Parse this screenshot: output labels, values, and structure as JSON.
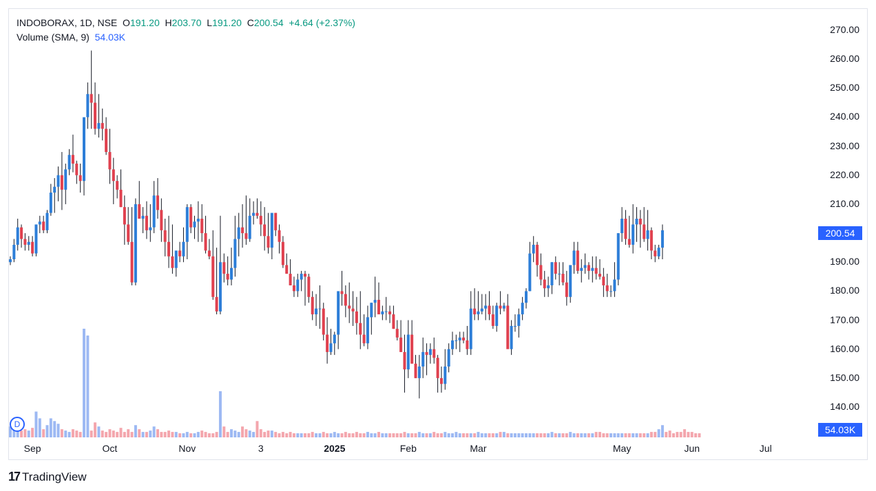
{
  "legend": {
    "symbol": "INDOBORAX, 1D, NSE",
    "o_label": "O",
    "o_value": "191.20",
    "h_label": "H",
    "h_value": "203.70",
    "l_label": "L",
    "l_value": "191.20",
    "c_label": "C",
    "c_value": "200.54",
    "change": "+4.64 (+2.37%)",
    "volume_label": "Volume (SMA, 9)",
    "volume_value": "54.03K"
  },
  "price_tag": "200.54",
  "volume_tag": "54.03K",
  "badge": "D",
  "brand": {
    "logo": "17",
    "name": "TradingView"
  },
  "colors": {
    "up": "#2d7ed8",
    "down": "#e0414f",
    "up_vol": "#9db9f3",
    "down_vol": "#f4a6ad",
    "accent": "#2962ff"
  },
  "chart_data": {
    "type": "candlestick",
    "title": "INDOBORAX, 1D, NSE",
    "y_ticks": [
      "270.00",
      "260.00",
      "250.00",
      "240.00",
      "230.00",
      "220.00",
      "210.00",
      "200.00",
      "190.00",
      "180.00",
      "170.00",
      "160.00",
      "150.00",
      "140.00"
    ],
    "ylim": [
      135,
      275
    ],
    "x_ticks": [
      {
        "label": "Sep",
        "index": 6,
        "bold": false
      },
      {
        "label": "Oct",
        "index": 27,
        "bold": false
      },
      {
        "label": "Nov",
        "index": 48,
        "bold": false
      },
      {
        "label": "3",
        "index": 68,
        "bold": false
      },
      {
        "label": "2025",
        "index": 88,
        "bold": true
      },
      {
        "label": "Feb",
        "index": 108,
        "bold": false
      },
      {
        "label": "Mar",
        "index": 127,
        "bold": false
      },
      {
        "label": "May",
        "index": 166,
        "bold": false
      },
      {
        "label": "Jun",
        "index": 185,
        "bold": false
      },
      {
        "label": "Jul",
        "index": 205,
        "bold": false
      }
    ],
    "candles": [
      [
        190,
        192,
        189,
        191
      ],
      [
        191,
        198,
        190,
        196
      ],
      [
        196,
        205,
        194,
        202
      ],
      [
        202,
        203,
        195,
        198
      ],
      [
        198,
        200,
        194,
        196
      ],
      [
        196,
        199,
        194,
        197
      ],
      [
        197,
        199,
        192,
        193
      ],
      [
        193,
        203,
        192,
        203
      ],
      [
        203,
        206,
        200,
        204
      ],
      [
        204,
        206,
        200,
        201
      ],
      [
        201,
        208,
        200,
        207
      ],
      [
        207,
        217,
        206,
        214
      ],
      [
        214,
        219,
        207,
        216
      ],
      [
        216,
        223,
        211,
        220
      ],
      [
        220,
        228,
        208,
        215
      ],
      [
        215,
        224,
        210,
        222
      ],
      [
        222,
        229,
        220,
        227
      ],
      [
        227,
        234,
        221,
        224
      ],
      [
        224,
        225,
        217,
        220
      ],
      [
        220,
        224,
        214,
        218
      ],
      [
        218,
        230,
        213,
        240
      ],
      [
        240,
        252,
        236,
        248
      ],
      [
        248,
        263,
        236,
        245
      ],
      [
        245,
        252,
        234,
        236
      ],
      [
        236,
        248,
        233,
        238
      ],
      [
        238,
        243,
        232,
        236
      ],
      [
        236,
        240,
        227,
        228
      ],
      [
        228,
        236,
        217,
        222
      ],
      [
        222,
        226,
        210,
        218
      ],
      [
        218,
        220,
        212,
        215
      ],
      [
        215,
        222,
        209,
        209
      ],
      [
        209,
        213,
        196,
        203
      ],
      [
        203,
        209,
        196,
        197
      ],
      [
        197,
        209,
        182,
        183
      ],
      [
        183,
        212,
        182,
        210
      ],
      [
        210,
        218,
        206,
        205
      ],
      [
        205,
        209,
        200,
        206
      ],
      [
        206,
        211,
        198,
        201
      ],
      [
        201,
        210,
        197,
        202
      ],
      [
        202,
        218,
        200,
        213
      ],
      [
        213,
        219,
        205,
        208
      ],
      [
        208,
        212,
        197,
        201
      ],
      [
        201,
        205,
        192,
        197
      ],
      [
        197,
        206,
        188,
        192
      ],
      [
        192,
        203,
        186,
        188
      ],
      [
        188,
        191,
        185,
        194
      ],
      [
        194,
        197,
        190,
        192
      ],
      [
        192,
        202,
        190,
        197
      ],
      [
        197,
        210,
        191,
        209
      ],
      [
        209,
        210,
        200,
        202
      ],
      [
        202,
        206,
        198,
        204
      ],
      [
        204,
        211,
        197,
        205
      ],
      [
        205,
        210,
        197,
        200
      ],
      [
        200,
        206,
        193,
        194
      ],
      [
        194,
        198,
        191,
        192
      ],
      [
        192,
        201,
        177,
        178
      ],
      [
        178,
        195,
        172,
        173
      ],
      [
        173,
        206,
        172,
        190
      ],
      [
        190,
        193,
        183,
        186
      ],
      [
        186,
        192,
        182,
        184
      ],
      [
        184,
        195,
        182,
        188
      ],
      [
        188,
        206,
        185,
        198
      ],
      [
        198,
        207,
        192,
        202
      ],
      [
        202,
        210,
        195,
        200
      ],
      [
        200,
        213,
        196,
        198
      ],
      [
        198,
        212,
        197,
        206
      ],
      [
        206,
        211,
        203,
        207
      ],
      [
        207,
        212,
        205,
        206
      ],
      [
        206,
        211,
        199,
        203
      ],
      [
        203,
        209,
        194,
        199
      ],
      [
        199,
        207,
        193,
        195
      ],
      [
        195,
        206,
        191,
        207
      ],
      [
        207,
        207,
        199,
        201
      ],
      [
        201,
        203,
        193,
        197
      ],
      [
        197,
        199,
        188,
        189
      ],
      [
        189,
        193,
        186,
        186
      ],
      [
        186,
        191,
        182,
        182
      ],
      [
        182,
        185,
        178,
        180
      ],
      [
        180,
        186,
        178,
        184
      ],
      [
        184,
        187,
        180,
        186
      ],
      [
        186,
        187,
        175,
        185
      ],
      [
        185,
        186,
        176,
        178
      ],
      [
        178,
        180,
        170,
        172
      ],
      [
        172,
        179,
        168,
        174
      ],
      [
        174,
        182,
        167,
        174
      ],
      [
        174,
        176,
        163,
        165
      ],
      [
        165,
        171,
        155,
        159
      ],
      [
        159,
        167,
        158,
        162
      ],
      [
        162,
        166,
        158,
        165
      ],
      [
        165,
        176,
        160,
        180
      ],
      [
        180,
        187,
        175,
        179
      ],
      [
        179,
        182,
        171,
        175
      ],
      [
        175,
        183,
        169,
        174
      ],
      [
        174,
        180,
        168,
        173
      ],
      [
        173,
        178,
        165,
        169
      ],
      [
        169,
        180,
        160,
        165
      ],
      [
        165,
        172,
        161,
        162
      ],
      [
        162,
        175,
        160,
        171
      ],
      [
        171,
        176,
        165,
        176
      ],
      [
        176,
        185,
        171,
        177
      ],
      [
        177,
        183,
        174,
        172
      ],
      [
        172,
        175,
        170,
        173
      ],
      [
        173,
        178,
        170,
        173
      ],
      [
        173,
        175,
        169,
        172
      ],
      [
        172,
        175,
        167,
        167
      ],
      [
        167,
        170,
        163,
        164
      ],
      [
        164,
        170,
        159,
        159
      ],
      [
        159,
        165,
        145,
        153
      ],
      [
        153,
        170,
        150,
        165
      ],
      [
        165,
        170,
        155,
        155
      ],
      [
        155,
        158,
        150,
        150
      ],
      [
        150,
        158,
        143,
        154
      ],
      [
        154,
        164,
        150,
        159
      ],
      [
        159,
        162,
        151,
        158
      ],
      [
        158,
        162,
        155,
        160
      ],
      [
        160,
        164,
        155,
        157
      ],
      [
        157,
        158,
        145,
        150
      ],
      [
        150,
        154,
        145,
        148
      ],
      [
        148,
        160,
        146,
        154
      ],
      [
        154,
        162,
        152,
        160
      ],
      [
        160,
        166,
        158,
        163
      ],
      [
        163,
        165,
        160,
        163
      ],
      [
        163,
        166,
        159,
        164
      ],
      [
        164,
        166,
        162,
        163
      ],
      [
        163,
        168,
        158,
        160
      ],
      [
        160,
        180,
        158,
        174
      ],
      [
        174,
        181,
        170,
        172
      ],
      [
        172,
        180,
        170,
        173
      ],
      [
        173,
        179,
        172,
        174
      ],
      [
        174,
        179,
        170,
        175
      ],
      [
        175,
        180,
        170,
        172
      ],
      [
        172,
        175,
        167,
        168
      ],
      [
        168,
        176,
        166,
        175
      ],
      [
        175,
        180,
        172,
        174
      ],
      [
        174,
        176,
        173,
        175
      ],
      [
        175,
        179,
        162,
        160
      ],
      [
        160,
        170,
        158,
        168
      ],
      [
        168,
        172,
        166,
        168
      ],
      [
        168,
        174,
        164,
        172
      ],
      [
        172,
        178,
        170,
        176
      ],
      [
        176,
        181,
        174,
        180
      ],
      [
        180,
        197,
        180,
        193
      ],
      [
        193,
        199,
        190,
        196
      ],
      [
        196,
        197,
        185,
        189
      ],
      [
        189,
        193,
        182,
        184
      ],
      [
        184,
        187,
        178,
        181
      ],
      [
        181,
        185,
        178,
        182
      ],
      [
        182,
        190,
        179,
        190
      ],
      [
        190,
        192,
        184,
        186
      ],
      [
        186,
        190,
        182,
        186
      ],
      [
        186,
        190,
        182,
        183
      ],
      [
        183,
        187,
        175,
        178
      ],
      [
        178,
        188,
        176,
        189
      ],
      [
        189,
        197,
        186,
        194
      ],
      [
        194,
        197,
        186,
        187
      ],
      [
        187,
        191,
        183,
        188
      ],
      [
        188,
        193,
        186,
        189
      ],
      [
        189,
        190,
        184,
        187
      ],
      [
        187,
        192,
        183,
        188
      ],
      [
        188,
        192,
        184,
        186
      ],
      [
        186,
        191,
        184,
        185
      ],
      [
        185,
        188,
        178,
        182
      ],
      [
        182,
        186,
        178,
        180
      ],
      [
        180,
        182,
        178,
        180
      ],
      [
        180,
        190,
        178,
        184
      ],
      [
        184,
        200,
        182,
        200
      ],
      [
        200,
        209,
        197,
        205
      ],
      [
        205,
        208,
        196,
        198
      ],
      [
        198,
        206,
        195,
        196
      ],
      [
        196,
        210,
        193,
        203
      ],
      [
        203,
        209,
        197,
        205
      ],
      [
        205,
        208,
        195,
        203
      ],
      [
        203,
        209,
        197,
        198
      ],
      [
        198,
        208,
        194,
        201
      ],
      [
        201,
        202,
        191,
        194
      ],
      [
        194,
        196,
        190,
        192
      ],
      [
        192,
        196,
        191,
        195
      ],
      [
        195,
        203,
        191,
        201
      ]
    ],
    "volume": [
      8,
      6,
      10,
      5,
      6,
      5,
      7,
      19,
      14,
      6,
      9,
      14,
      12,
      10,
      6,
      5,
      4,
      6,
      5,
      4,
      80,
      75,
      5,
      11,
      8,
      5,
      4,
      6,
      5,
      4,
      7,
      4,
      6,
      4,
      9,
      6,
      4,
      4,
      5,
      8,
      6,
      4,
      4,
      5,
      4,
      4,
      3,
      3,
      4,
      3,
      3,
      4,
      5,
      4,
      3,
      3,
      4,
      34,
      8,
      4,
      6,
      5,
      4,
      8,
      6,
      5,
      4,
      12,
      6,
      4,
      5,
      5,
      4,
      3,
      4,
      3,
      4,
      3,
      3,
      3,
      3,
      3,
      4,
      3,
      3,
      4,
      3,
      3,
      4,
      3,
      3,
      4,
      3,
      3,
      4,
      3,
      3,
      4,
      3,
      3,
      4,
      3,
      3,
      3,
      3,
      3,
      3,
      4,
      3,
      3,
      3,
      4,
      3,
      3,
      3,
      4,
      3,
      3,
      4,
      3,
      3,
      4,
      3,
      3,
      3,
      3,
      3,
      4,
      3,
      3,
      3,
      3,
      3,
      4,
      4,
      3,
      3,
      3,
      3,
      3,
      3,
      3,
      3,
      3,
      3,
      3,
      3,
      4,
      3,
      3,
      3,
      3,
      4,
      3,
      3,
      3,
      3,
      3,
      3,
      4,
      4,
      3,
      3,
      3,
      3,
      3,
      3,
      3,
      3,
      3,
      3,
      3,
      3,
      3,
      4,
      4,
      6,
      9,
      4,
      5,
      3,
      4,
      4,
      6,
      4,
      4,
      3,
      3
    ]
  }
}
